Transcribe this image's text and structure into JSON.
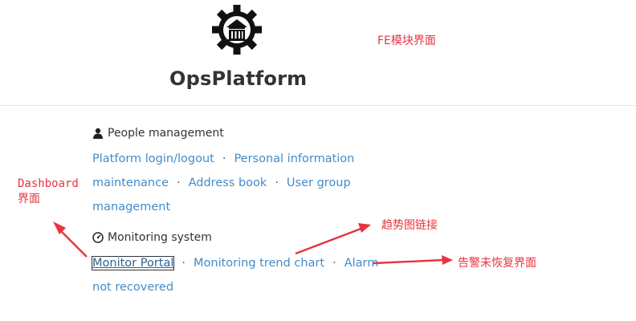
{
  "header": {
    "logo_icon": "gear-house-icon",
    "title": "OpsPlatform"
  },
  "annotations": {
    "fe_label": "FE模块界面",
    "dashboard_label_line1": "Dashboard",
    "dashboard_label_line2": "界面",
    "trend_label": "趋势图链接",
    "alarm_label": "告警未恢复界面",
    "color": "#e8333f"
  },
  "people_section": {
    "icon": "user-icon",
    "heading": "People management",
    "links": {
      "login": "Platform login/logout",
      "personal_line1": "Personal information",
      "personal_line2": "maintenance",
      "address_book": "Address book",
      "user_group_line1": "User group",
      "user_group_line2": "management"
    },
    "separator": "·"
  },
  "monitoring_section": {
    "icon": "dashboard-gauge-icon",
    "heading": "Monitoring system",
    "links": {
      "portal": "Monitor Portal",
      "trend": "Monitoring trend chart",
      "alarm_line1": "Alarm",
      "alarm_line2": "not recovered"
    },
    "separator": "·"
  },
  "colors": {
    "link": "#428bca",
    "text": "#333333",
    "divider": "#e6e6e6"
  }
}
